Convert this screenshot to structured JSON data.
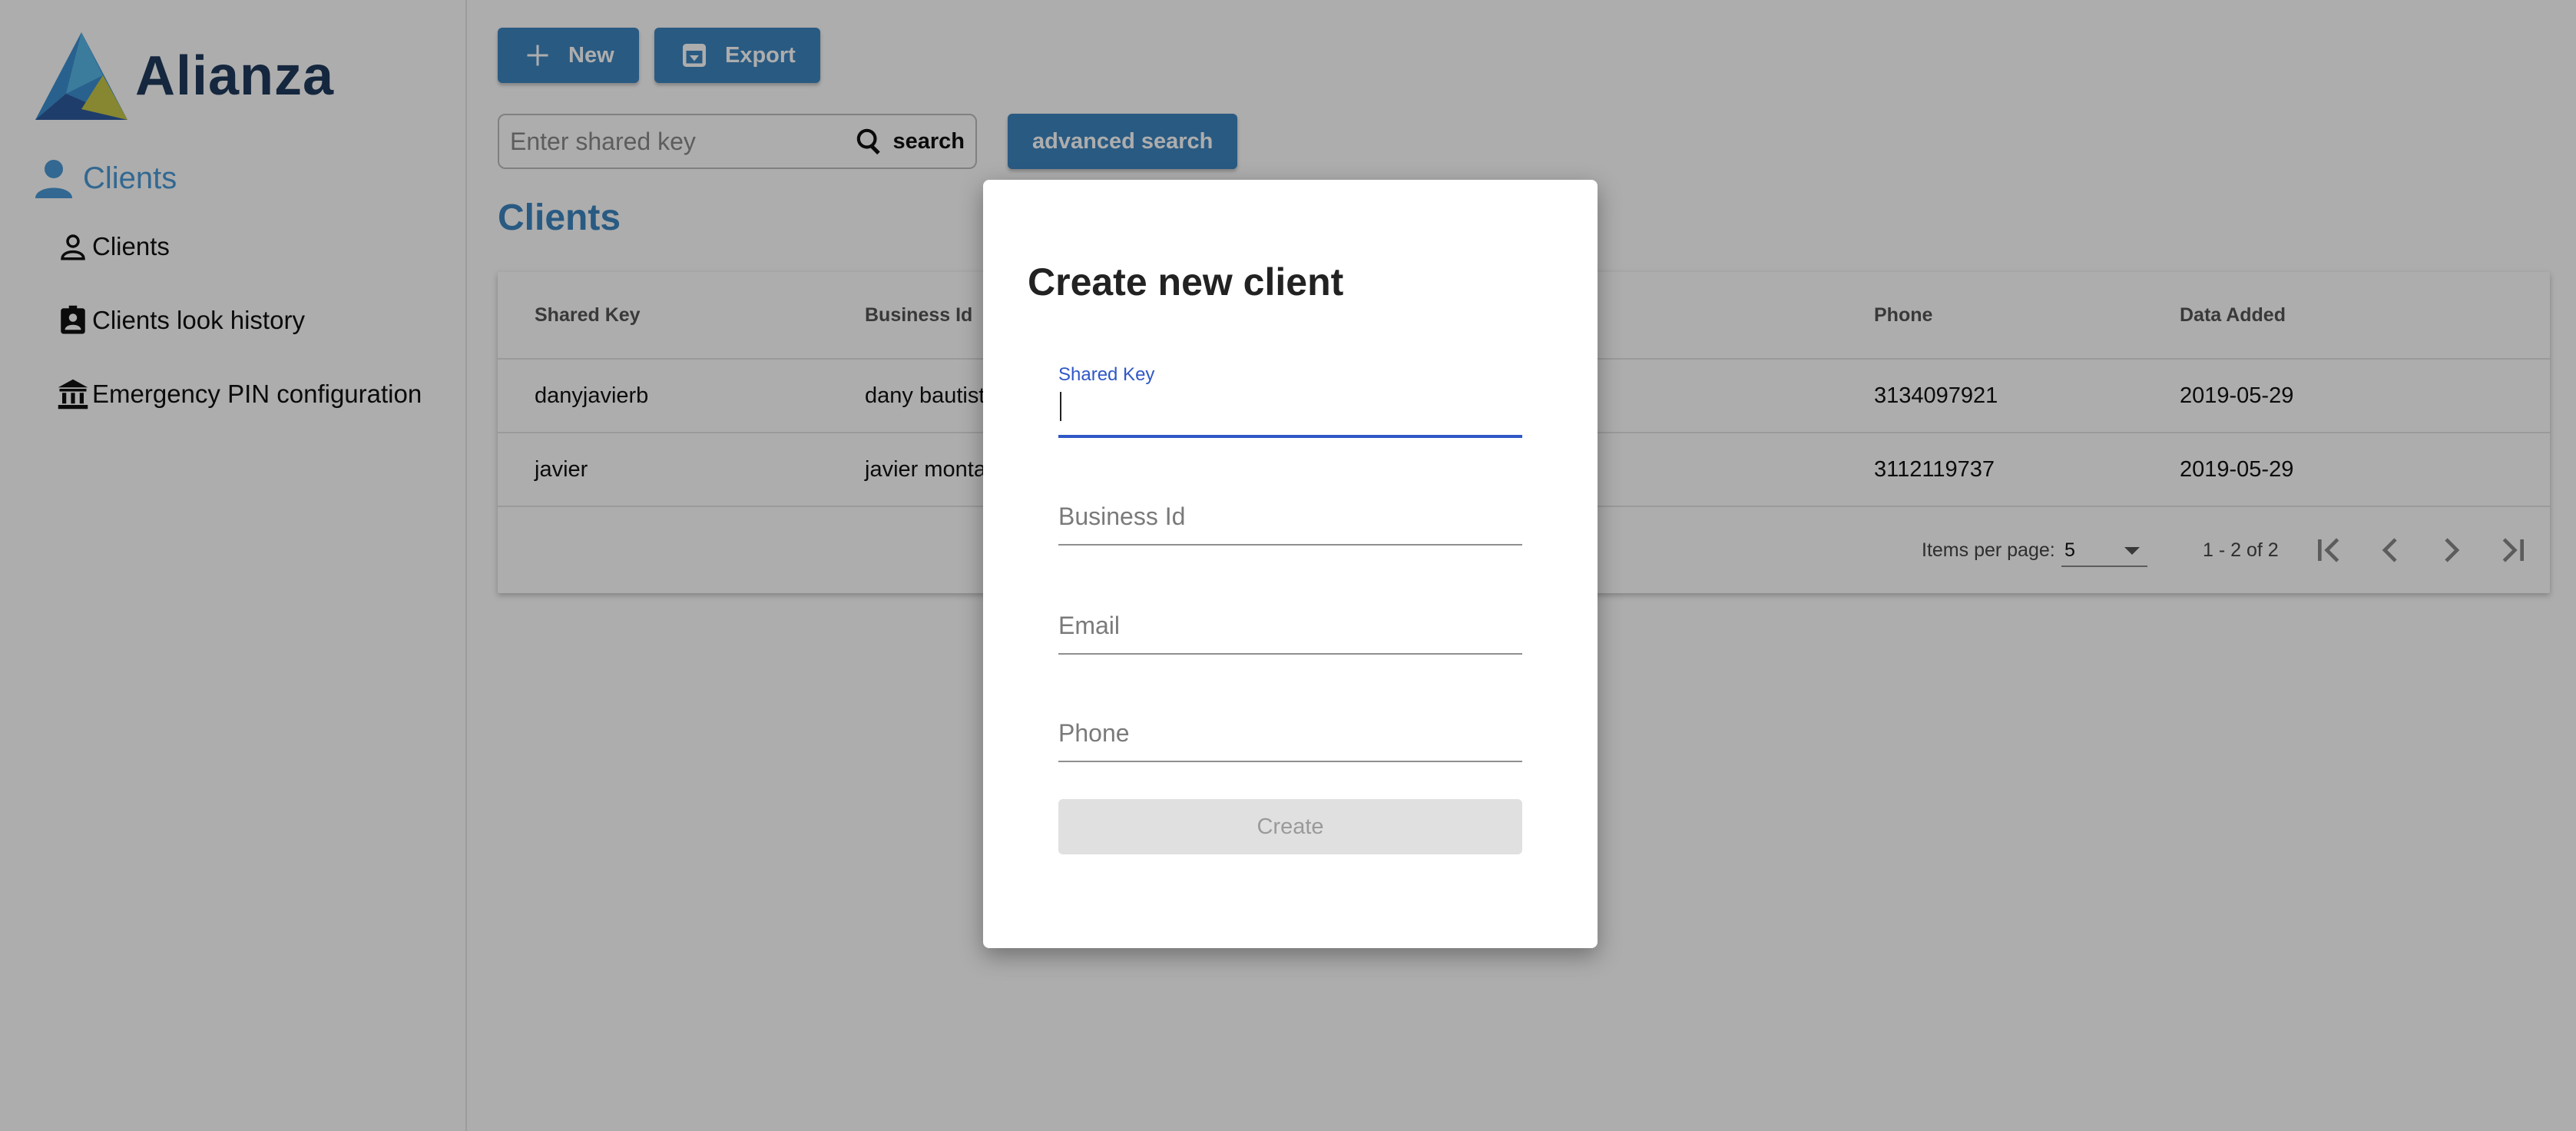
{
  "brand": {
    "name": "Alianza"
  },
  "sidebar": {
    "section_title": "Clients",
    "items": [
      {
        "label": "Clients",
        "icon": "person-outline-icon"
      },
      {
        "label": "Clients look history",
        "icon": "contact-badge-icon"
      },
      {
        "label": "Emergency PIN configuration",
        "icon": "bank-icon"
      }
    ]
  },
  "toolbar": {
    "new_label": "New",
    "export_label": "Export",
    "advanced_search_label": "advanced search"
  },
  "search": {
    "placeholder": "Enter shared key",
    "button_label": "search"
  },
  "page": {
    "title": "Clients"
  },
  "table": {
    "columns": [
      "Shared Key",
      "Business Id",
      "Phone",
      "Data Added"
    ],
    "rows": [
      {
        "shared_key": "danyjavierb",
        "business_id": "dany bautist",
        "phone": "3134097921",
        "date": "2019-05-29"
      },
      {
        "shared_key": "javier",
        "business_id": "javier monta",
        "phone": "3112119737",
        "date": "2019-05-29"
      }
    ]
  },
  "paginator": {
    "items_per_page_label": "Items per page:",
    "page_size": "5",
    "range_label": "1 - 2 of 2"
  },
  "dialog": {
    "title": "Create new client",
    "fields": {
      "shared_key": "Shared Key",
      "business_id": "Business Id",
      "email": "Email",
      "phone": "Phone"
    },
    "create_label": "Create"
  },
  "colors": {
    "accent": "#3d85c0",
    "focus": "#2f58c7",
    "title": "#1f3a5c"
  }
}
